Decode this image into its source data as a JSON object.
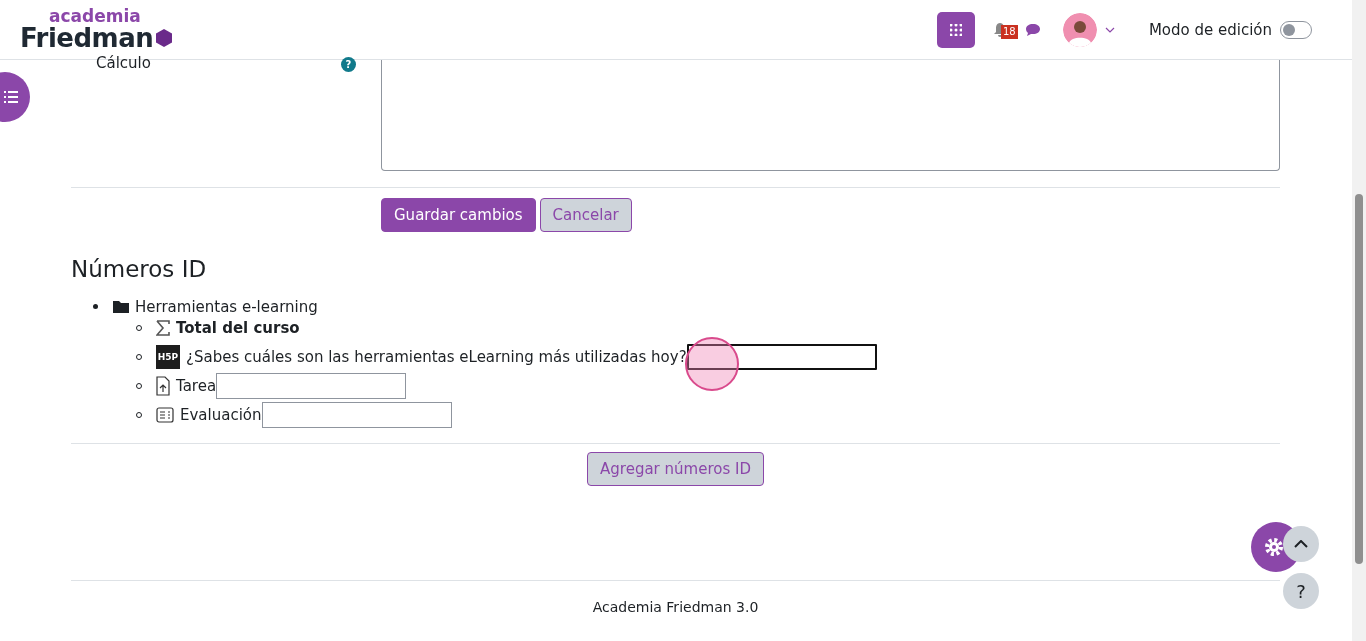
{
  "header": {
    "logo_top": "academia",
    "logo_bottom": "Friedman",
    "notification_count": "18",
    "edit_mode": {
      "label": "Modo de edición",
      "on": false
    }
  },
  "form": {
    "label": "Cálculo",
    "help": "?",
    "buttons": [
      {
        "label": "Guardar cambios",
        "kind": "primary"
      },
      {
        "label": "Cancelar",
        "kind": "secondary"
      }
    ]
  },
  "id_numbers": {
    "title": "Números ID",
    "category": "Herramientas e-learning",
    "items": [
      {
        "kind": "total",
        "label": "Total del curso"
      },
      {
        "kind": "h5p",
        "icon_text": "H5P",
        "label": "¿Sabes cuáles son las herramientas eLearning más utilizadas hoy?",
        "focused": true
      },
      {
        "kind": "assign",
        "label": "Tarea",
        "focused": false
      },
      {
        "kind": "quiz",
        "label": "Evaluación",
        "focused": false
      }
    ],
    "button": "Agregar números ID"
  },
  "footer": {
    "text": "Academia Friedman 3.0"
  },
  "floating": {
    "help": "?"
  }
}
